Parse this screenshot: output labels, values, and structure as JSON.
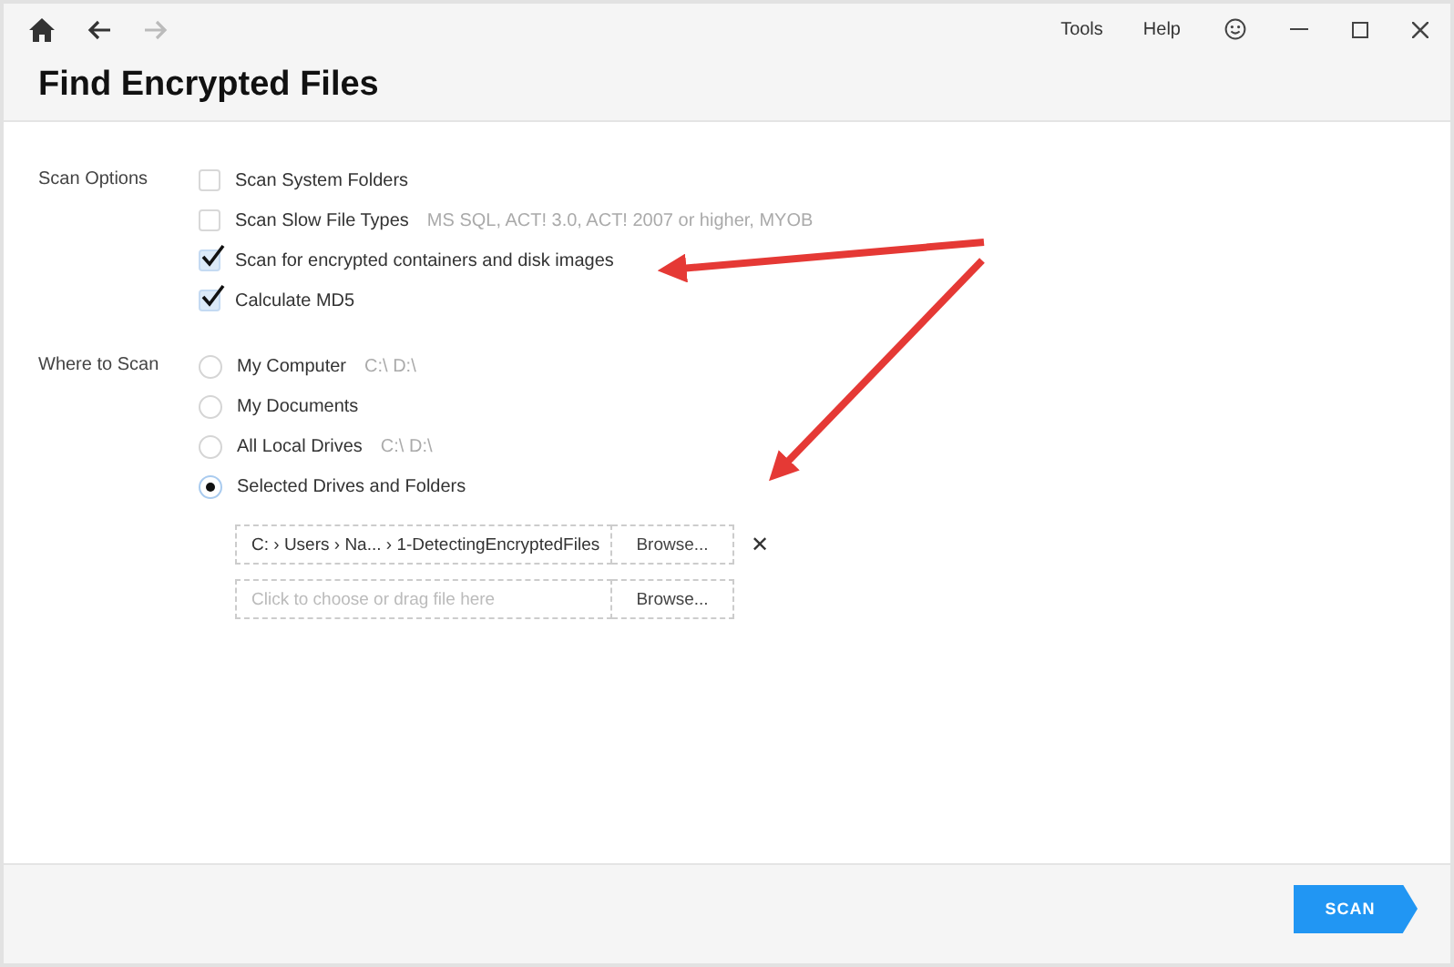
{
  "toolbar": {
    "menu": [
      "Tools",
      "Help"
    ]
  },
  "title": "Find Encrypted Files",
  "scan_options": {
    "label": "Scan Options",
    "items": [
      {
        "label": "Scan System Folders",
        "checked": false
      },
      {
        "label": "Scan Slow File Types",
        "detail": "MS SQL, ACT! 3.0, ACT! 2007 or higher, MYOB",
        "checked": false
      },
      {
        "label": "Scan for encrypted containers and disk images",
        "checked": true
      },
      {
        "label": "Calculate MD5",
        "checked": true
      }
    ]
  },
  "where_to_scan": {
    "label": "Where to Scan",
    "items": [
      {
        "label": "My Computer",
        "detail": "C:\\ D:\\",
        "selected": false
      },
      {
        "label": "My Documents",
        "selected": false
      },
      {
        "label": "All Local Drives",
        "detail": "C:\\ D:\\",
        "selected": false
      },
      {
        "label": "Selected Drives and Folders",
        "selected": true
      }
    ]
  },
  "paths": [
    {
      "value": "C: › Users › Na... › 1-DetectingEncryptedFiles",
      "browse": "Browse...",
      "remove": "✕"
    },
    {
      "placeholder": "Click to choose or drag file here",
      "browse": "Browse..."
    }
  ],
  "footer": {
    "button": "SCAN"
  }
}
